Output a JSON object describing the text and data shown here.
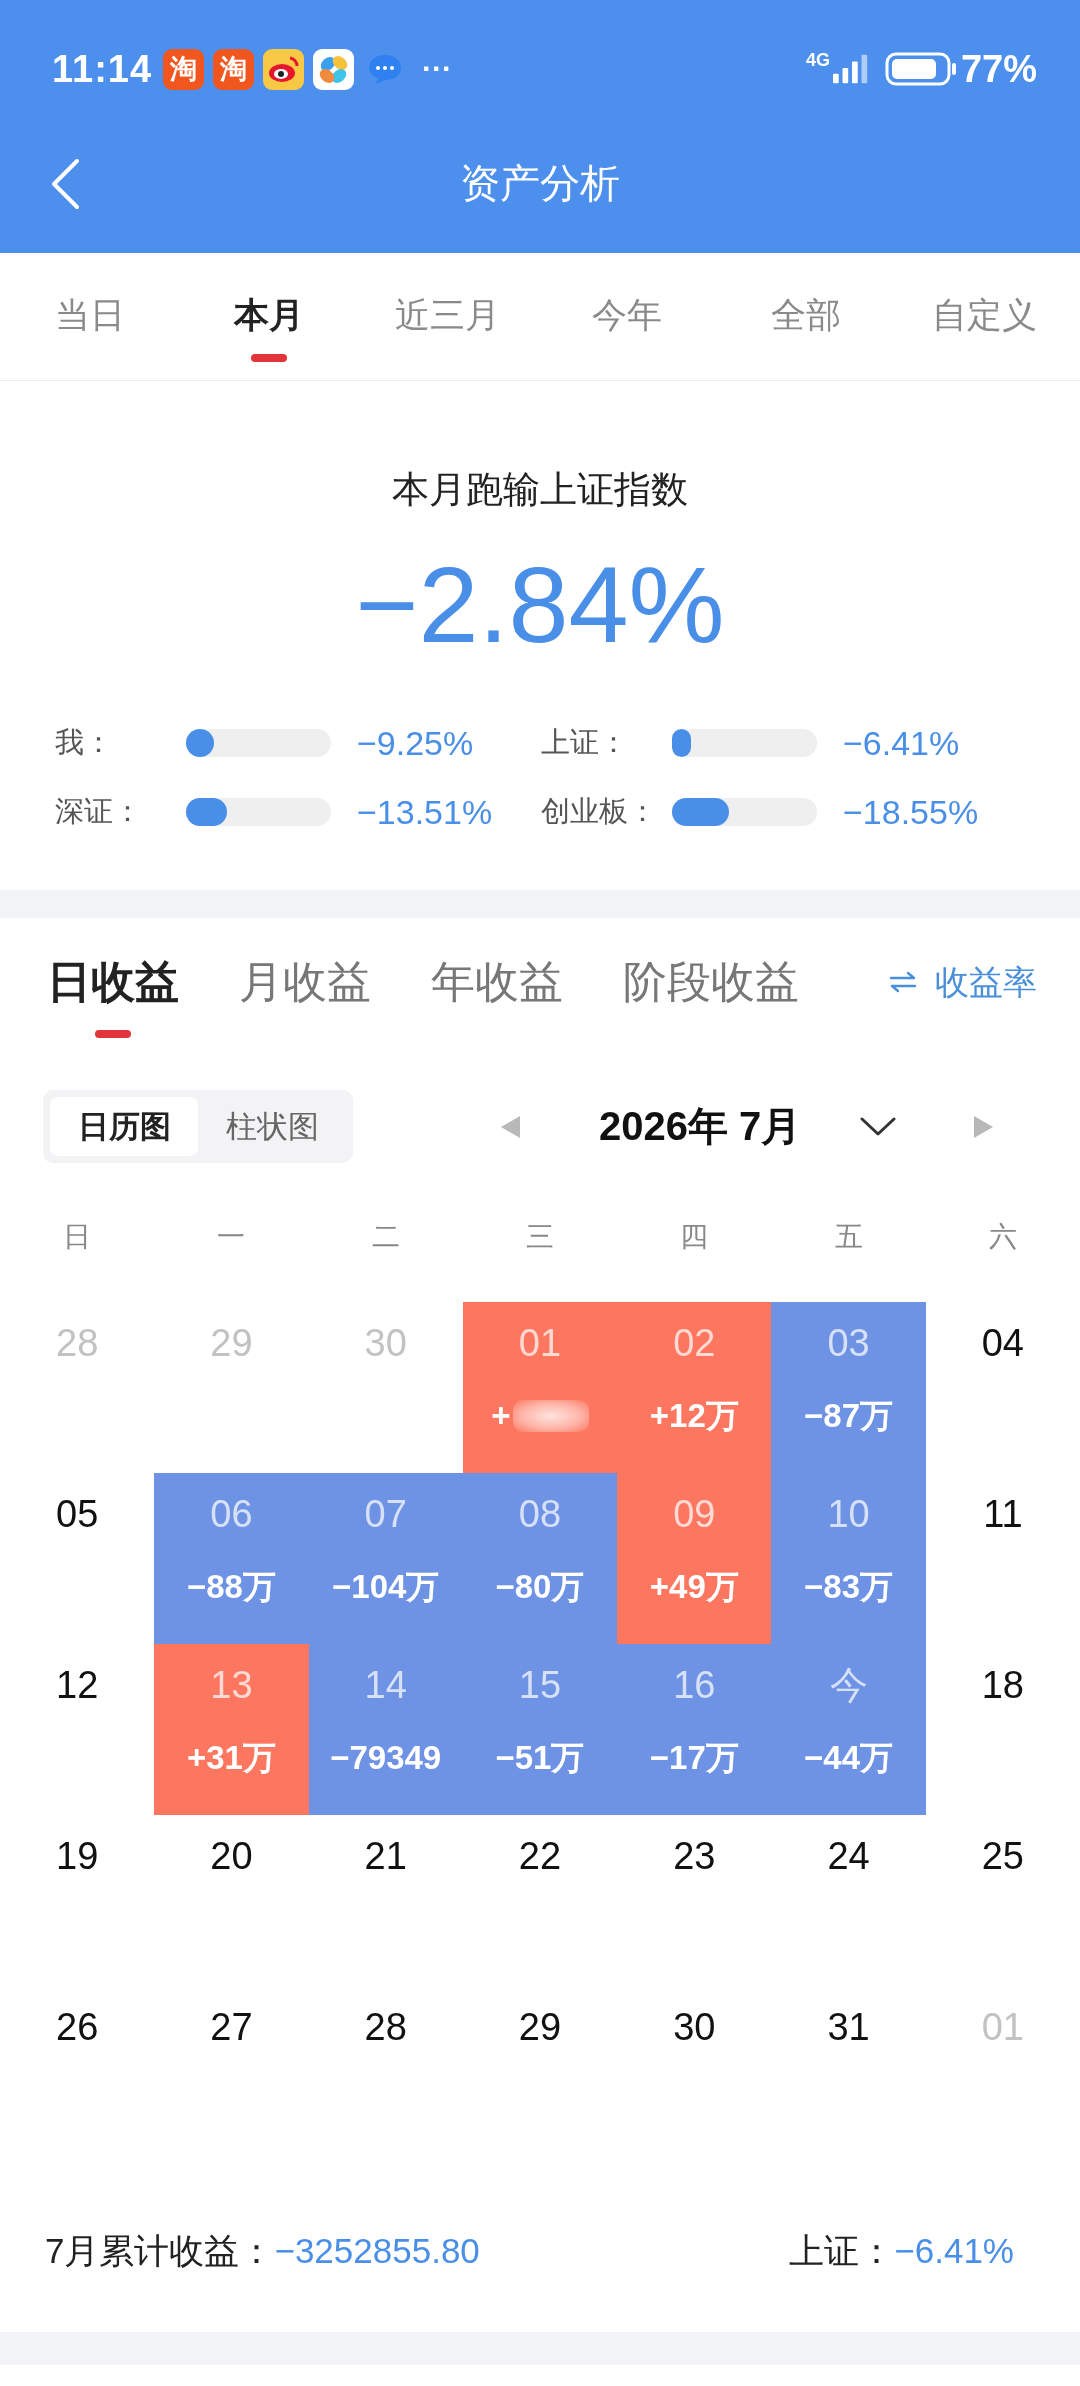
{
  "status_bar": {
    "time": "11:14",
    "notifications": [
      {
        "kind": "glyph",
        "glyph": "淘"
      },
      {
        "kind": "glyph",
        "glyph": "淘"
      },
      {
        "kind": "eye"
      },
      {
        "kind": "pinwheel"
      },
      {
        "kind": "chat"
      }
    ],
    "overflow": "···",
    "network": "4G",
    "battery": "77%"
  },
  "header": {
    "title": "资产分析"
  },
  "period_tabs": [
    {
      "label": "当日",
      "selected": false
    },
    {
      "label": "本月",
      "selected": true
    },
    {
      "label": "近三月",
      "selected": false
    },
    {
      "label": "今年",
      "selected": false
    },
    {
      "label": "全部",
      "selected": false
    },
    {
      "label": "自定义",
      "selected": false
    }
  ],
  "summary": {
    "title": "本月跑输上证指数",
    "value": "−2.84%",
    "comparisons": [
      {
        "label": "我：",
        "level": 0.19,
        "reading": "−9.25%"
      },
      {
        "label": "上证：",
        "level": 0.13,
        "reading": "−6.41%"
      },
      {
        "label": "深证：",
        "level": 0.28,
        "reading": "−13.51%"
      },
      {
        "label": "创业板：",
        "level": 0.39,
        "reading": "−18.55%"
      }
    ]
  },
  "returns": {
    "tabs": [
      {
        "label": "日收益",
        "selected": true
      },
      {
        "label": "月收益",
        "selected": false
      },
      {
        "label": "年收益",
        "selected": false
      },
      {
        "label": "阶段收益",
        "selected": false
      }
    ],
    "rate_toggle": "收益率",
    "views": [
      {
        "label": "日历图",
        "selected": true
      },
      {
        "label": "柱状图",
        "selected": false
      }
    ],
    "month": "2026年 7月"
  },
  "calendar": {
    "weekdays": [
      "日",
      "一",
      "二",
      "三",
      "四",
      "五",
      "六"
    ],
    "weeks": [
      {
        "days": [
          {
            "day": "28",
            "outside_month": true
          },
          {
            "day": "29",
            "outside_month": true
          },
          {
            "day": "30",
            "outside_month": true
          },
          {
            "day": "01",
            "outside_month": false,
            "color": "#fd7760",
            "value": "+",
            "redacted": true
          },
          {
            "day": "02",
            "outside_month": false,
            "color": "#fd7760",
            "value": "+12万",
            "redacted": false
          },
          {
            "day": "03",
            "outside_month": false,
            "color": "#6e92e4",
            "value": "−87万",
            "redacted": false
          },
          {
            "day": "04",
            "outside_month": false
          }
        ]
      },
      {
        "days": [
          {
            "day": "05",
            "outside_month": false
          },
          {
            "day": "06",
            "outside_month": false,
            "color": "#6e92e4",
            "value": "−88万",
            "redacted": false
          },
          {
            "day": "07",
            "outside_month": false,
            "color": "#6e92e4",
            "value": "−104万",
            "redacted": false
          },
          {
            "day": "08",
            "outside_month": false,
            "color": "#6e92e4",
            "value": "−80万",
            "redacted": false
          },
          {
            "day": "09",
            "outside_month": false,
            "color": "#fd7760",
            "value": "+49万",
            "redacted": false
          },
          {
            "day": "10",
            "outside_month": false,
            "color": "#6e92e4",
            "value": "−83万",
            "redacted": false
          },
          {
            "day": "11",
            "outside_month": false
          }
        ]
      },
      {
        "days": [
          {
            "day": "12",
            "outside_month": false
          },
          {
            "day": "13",
            "outside_month": false,
            "color": "#fd7760",
            "value": "+31万",
            "redacted": false
          },
          {
            "day": "14",
            "outside_month": false,
            "color": "#6e92e4",
            "value": "−79349",
            "redacted": false
          },
          {
            "day": "15",
            "outside_month": false,
            "color": "#6e92e4",
            "value": "−51万",
            "redacted": false
          },
          {
            "day": "16",
            "outside_month": false,
            "color": "#6e92e4",
            "value": "−17万",
            "redacted": false
          },
          {
            "day": "今",
            "outside_month": false,
            "color": "#6e92e4",
            "value": "−44万",
            "redacted": false
          },
          {
            "day": "18",
            "outside_month": false
          }
        ]
      },
      {
        "days": [
          {
            "day": "19",
            "outside_month": false
          },
          {
            "day": "20",
            "outside_month": false
          },
          {
            "day": "21",
            "outside_month": false
          },
          {
            "day": "22",
            "outside_month": false
          },
          {
            "day": "23",
            "outside_month": false
          },
          {
            "day": "24",
            "outside_month": false
          },
          {
            "day": "25",
            "outside_month": false
          }
        ]
      },
      {
        "days": [
          {
            "day": "26",
            "outside_month": false
          },
          {
            "day": "27",
            "outside_month": false
          },
          {
            "day": "28",
            "outside_month": false
          },
          {
            "day": "29",
            "outside_month": false
          },
          {
            "day": "30",
            "outside_month": false
          },
          {
            "day": "31",
            "outside_month": false
          },
          {
            "day": "01",
            "outside_month": true
          }
        ]
      }
    ]
  },
  "footer": {
    "label": "7月累计收益：",
    "value": "−3252855.80",
    "index_label": "上证：",
    "index_value": "−6.41%"
  }
}
